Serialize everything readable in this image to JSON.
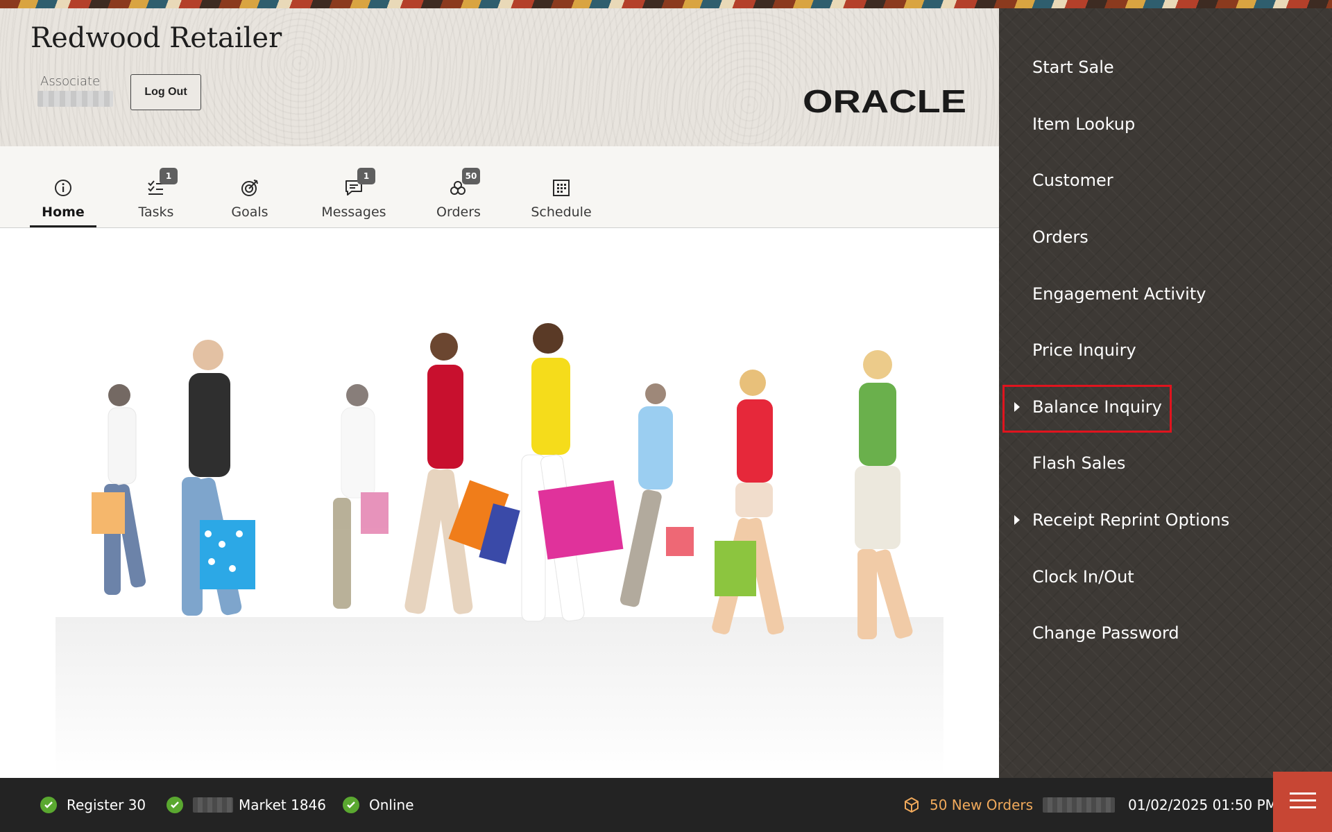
{
  "header": {
    "title": "Redwood Retailer",
    "associate_label": "Associate",
    "logout_label": "Log Out",
    "logo_text": "ORACLE"
  },
  "tabs": [
    {
      "label": "Home",
      "icon": "info-icon",
      "active": true
    },
    {
      "label": "Tasks",
      "icon": "tasks-icon",
      "badge": "1"
    },
    {
      "label": "Goals",
      "icon": "goals-icon"
    },
    {
      "label": "Messages",
      "icon": "messages-icon",
      "badge": "1"
    },
    {
      "label": "Orders",
      "icon": "orders-icon",
      "badge": "50"
    },
    {
      "label": "Schedule",
      "icon": "calendar-icon"
    }
  ],
  "menu": {
    "items": [
      {
        "label": "Start Sale"
      },
      {
        "label": "Item Lookup"
      },
      {
        "label": "Customer"
      },
      {
        "label": "Orders"
      },
      {
        "label": "Engagement Activity"
      },
      {
        "label": "Price Inquiry"
      },
      {
        "label": "Balance Inquiry",
        "has_submenu": true,
        "highlighted": true
      },
      {
        "label": "Flash Sales"
      },
      {
        "label": "Receipt Reprint Options",
        "has_submenu": true
      },
      {
        "label": "Clock In/Out"
      },
      {
        "label": "Change Password"
      }
    ]
  },
  "footer": {
    "register": "Register 30",
    "store": "Market 1846",
    "connection": "Online",
    "new_orders": "50 New Orders",
    "datetime": "01/02/2025 01:50 PM"
  },
  "colors": {
    "sidebar_bg": "#3d3935",
    "footer_bg": "#232323",
    "accent_red": "#c74634",
    "status_green": "#5aa830",
    "orders_orange": "#f0a95b",
    "highlight_red": "#e0141e"
  }
}
